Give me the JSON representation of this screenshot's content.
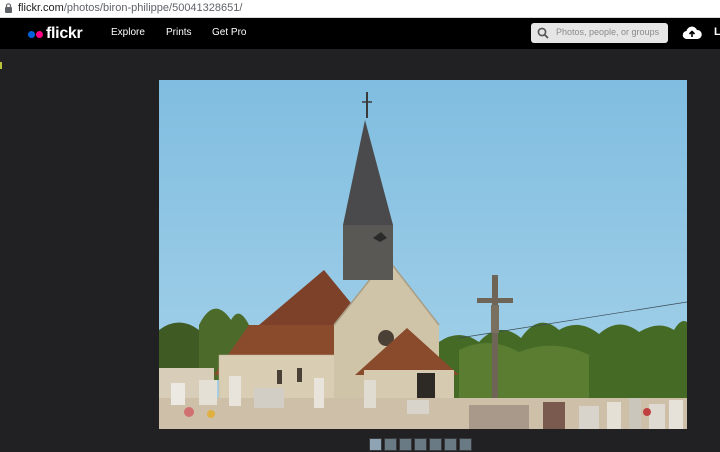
{
  "browser": {
    "url_domain": "flickr.com",
    "url_path": "/photos/biron-philippe/50041328651/",
    "lock_icon": "lock-icon"
  },
  "header": {
    "logo_text": "flickr",
    "logo_dot_colors": [
      "#0063dc",
      "#ff0084"
    ],
    "nav": [
      {
        "label": "Explore"
      },
      {
        "label": "Prints"
      },
      {
        "label": "Get Pro"
      }
    ],
    "search": {
      "placeholder": "Photos, people, or groups",
      "icon": "search-icon"
    },
    "upload_icon": "cloud-upload-icon",
    "user_initial": "L"
  },
  "photo": {
    "alt": "",
    "subject_icon": "church-photo"
  },
  "filmstrip": {
    "count": 7,
    "active_index": 0
  },
  "colors": {
    "page_bg": "#212124",
    "header_bg": "#000000",
    "sky": "#8ec4e2"
  }
}
